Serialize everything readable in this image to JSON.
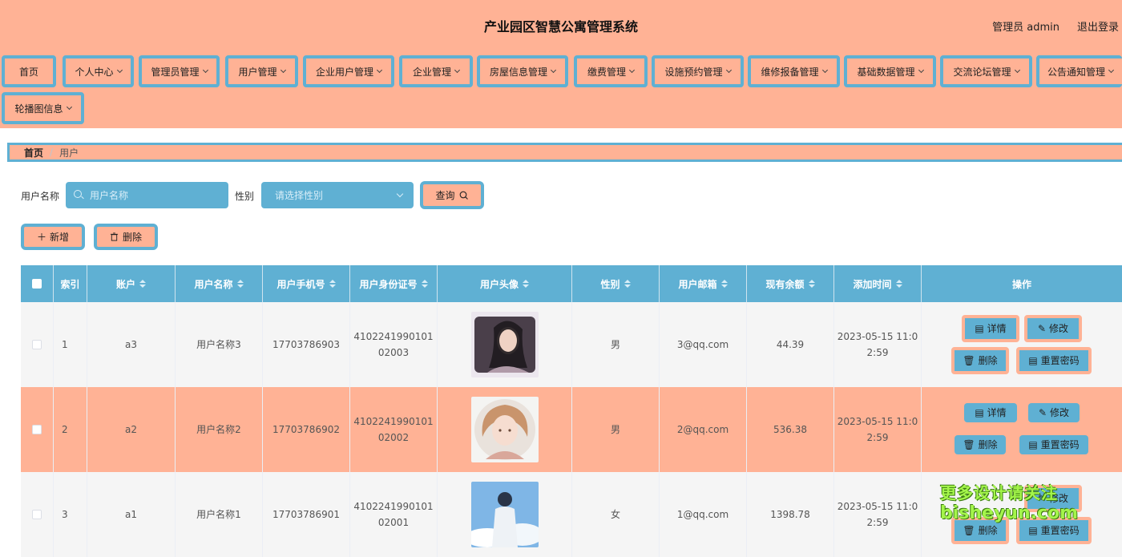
{
  "header": {
    "title": "产业园区智慧公寓管理系统",
    "admin_label": "管理员 admin",
    "logout_label": "退出登录"
  },
  "nav": {
    "items": [
      {
        "label": "首页",
        "dropdown": false
      },
      {
        "label": "个人中心",
        "dropdown": true
      },
      {
        "label": "管理员管理",
        "dropdown": true
      },
      {
        "label": "用户管理",
        "dropdown": true
      },
      {
        "label": "企业用户管理",
        "dropdown": true
      },
      {
        "label": "企业管理",
        "dropdown": true
      },
      {
        "label": "房屋信息管理",
        "dropdown": true
      },
      {
        "label": "缴费管理",
        "dropdown": true
      },
      {
        "label": "设施预约管理",
        "dropdown": true
      },
      {
        "label": "维修报备管理",
        "dropdown": true
      },
      {
        "label": "基础数据管理",
        "dropdown": true
      },
      {
        "label": "交流论坛管理",
        "dropdown": true
      },
      {
        "label": "公告通知管理",
        "dropdown": true
      },
      {
        "label": "轮播图信息",
        "dropdown": true
      }
    ]
  },
  "breadcrumb": {
    "home": "首页",
    "current": "用户"
  },
  "search": {
    "name_label": "用户名称",
    "name_placeholder": "用户名称",
    "gender_label": "性别",
    "gender_placeholder": "请选择性别",
    "query_label": "查询"
  },
  "actions": {
    "add_label": "新增",
    "delete_label": "删除"
  },
  "table": {
    "columns": [
      "索引",
      "账户",
      "用户名称",
      "用户手机号",
      "用户身份证号",
      "用户头像",
      "性别",
      "用户邮箱",
      "现有余额",
      "添加时间",
      "操作"
    ],
    "rows": [
      {
        "index": "1",
        "account": "a3",
        "name": "用户名称3",
        "phone": "17703786903",
        "id_line1": "4102241990101",
        "id_line2": "02003",
        "gender": "男",
        "email": "3@qq.com",
        "balance": "44.39",
        "time_line1": "2023-05-15 11:0",
        "time_line2": "2:59"
      },
      {
        "index": "2",
        "account": "a2",
        "name": "用户名称2",
        "phone": "17703786902",
        "id_line1": "4102241990101",
        "id_line2": "02002",
        "gender": "男",
        "email": "2@qq.com",
        "balance": "536.38",
        "time_line1": "2023-05-15 11:0",
        "time_line2": "2:59"
      },
      {
        "index": "3",
        "account": "a1",
        "name": "用户名称1",
        "phone": "17703786901",
        "id_line1": "4102241990101",
        "id_line2": "02001",
        "gender": "女",
        "email": "1@qq.com",
        "balance": "1398.78",
        "time_line1": "2023-05-15 11:0",
        "time_line2": "2:59"
      }
    ],
    "ops": {
      "detail": "详情",
      "edit": "修改",
      "delete": "删除",
      "reset_password": "重置密码"
    }
  },
  "watermark": {
    "line1": "更多设计请关注",
    "line2": "bisheyun.com"
  },
  "colors": {
    "accent_salmon": "#ffb295",
    "accent_blue": "#5fb0d3",
    "row_alt": "#f5f5f5"
  }
}
